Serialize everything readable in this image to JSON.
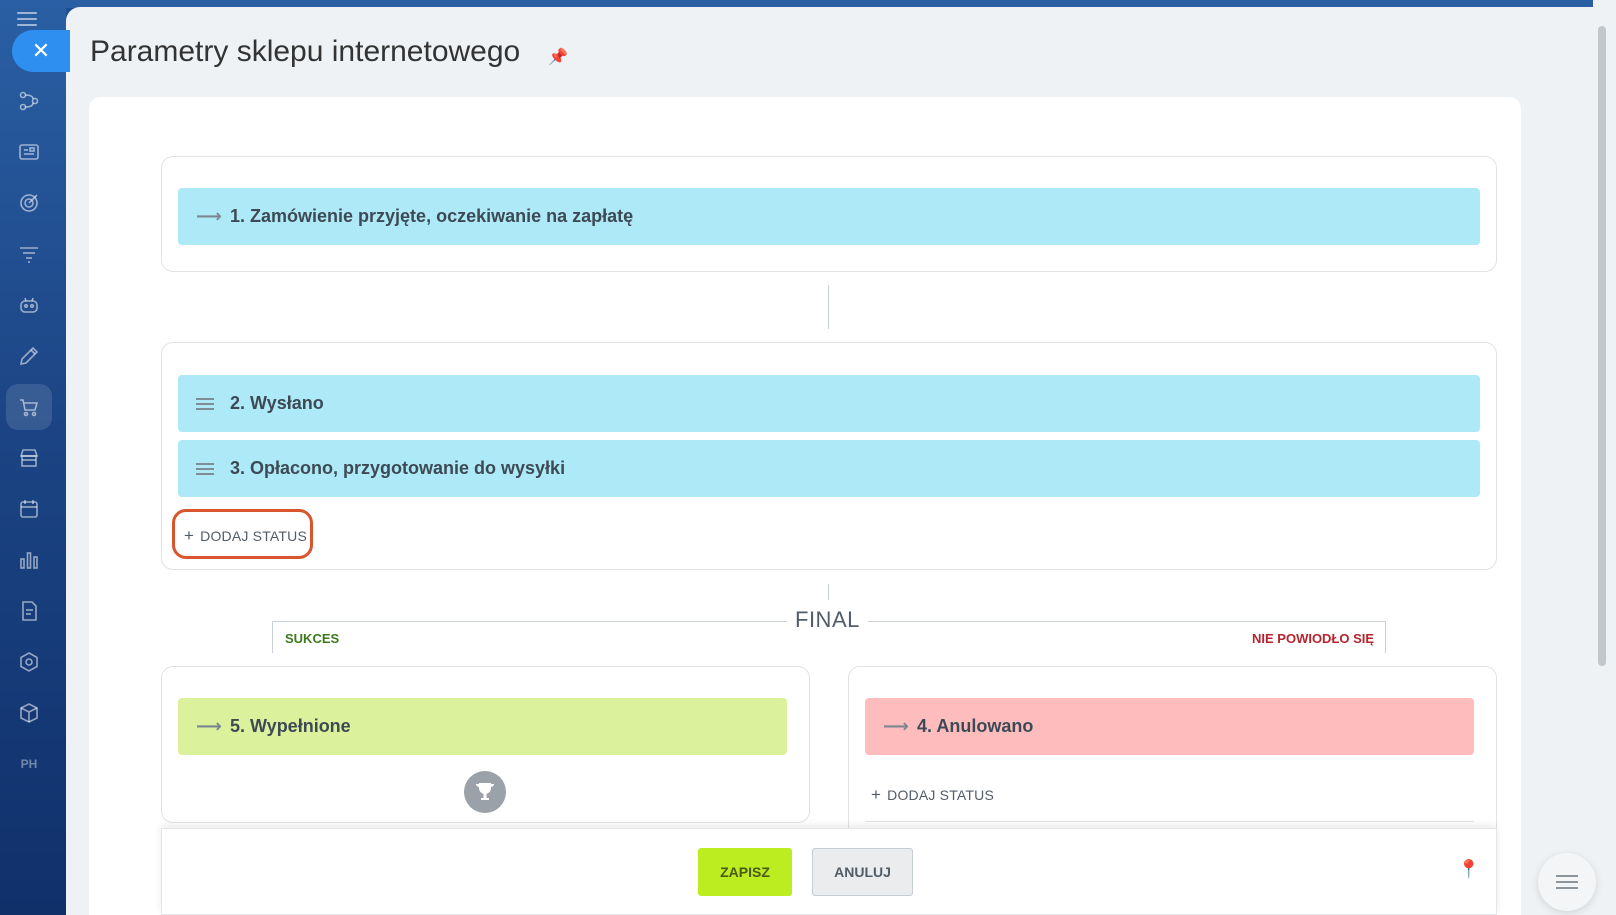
{
  "page": {
    "title": "Parametry sklepu internetowego"
  },
  "groups": {
    "initial": {
      "status": {
        "label": "1. Zamówienie przyjęte, oczekiwanie na zapłatę",
        "color": "#aee9f8"
      }
    },
    "intermediate": {
      "statuses": [
        {
          "label": "2. Wysłano",
          "color": "#aee9f8"
        },
        {
          "label": "3. Opłacono, przygotowanie do wysyłki",
          "color": "#aee9f8"
        }
      ],
      "add_label": "DODAJ STATUS"
    },
    "final": {
      "title": "FINAL",
      "success": {
        "heading": "SUKCES",
        "status": {
          "label": "5. Wypełnione",
          "color": "#dcf19b"
        }
      },
      "failure": {
        "heading": "NIE POWIODŁO SIĘ",
        "status": {
          "label": "4. Anulowano",
          "color": "#ffbcbd"
        },
        "add_label": "DODAJ STATUS"
      }
    }
  },
  "footer": {
    "save_label": "ZAPISZ",
    "cancel_label": "ANULUJ"
  },
  "colors": {
    "accent_save": "#bbed21",
    "highlight_outline": "#d9552e",
    "success_text": "#3d7a1e",
    "failure_text": "#b7242e"
  },
  "icons": {
    "rail": [
      "hamburger-icon",
      "close-icon",
      "flow-icon",
      "contact-card-icon",
      "target-icon",
      "funnel-icon",
      "robot-icon",
      "pencil-icon",
      "cart-icon",
      "store-icon",
      "calendar-icon",
      "chart-icon",
      "document-icon",
      "hexagon-icon",
      "box-icon",
      "ph-icon"
    ]
  }
}
